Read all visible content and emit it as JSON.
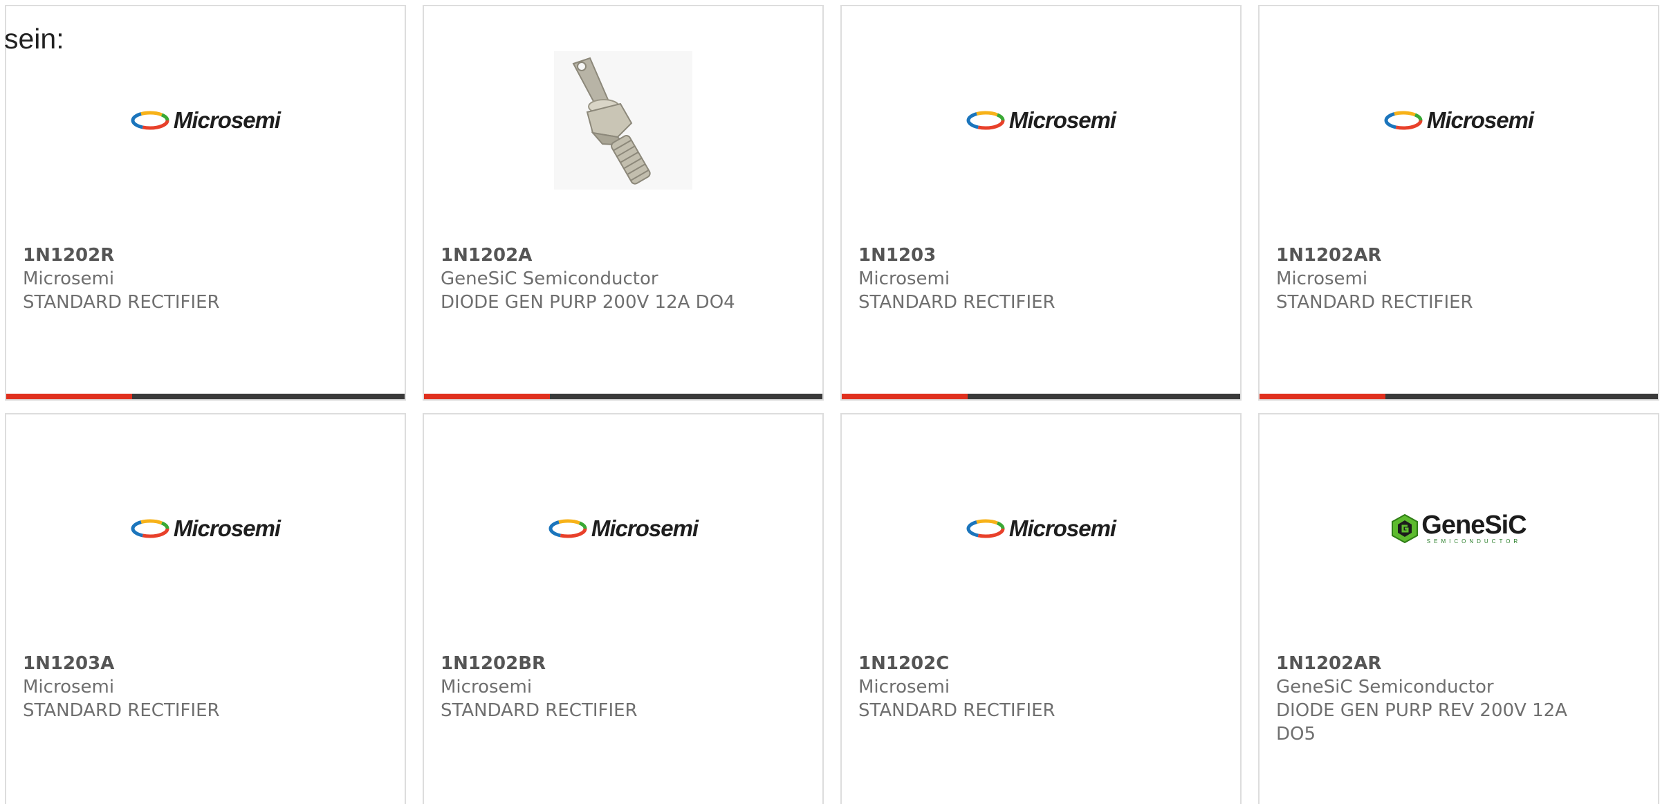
{
  "intro_text": "sein:",
  "logo_text": {
    "microsemi": "Microsemi",
    "genesic": "GeneSiC",
    "genesic_sub": "SEMICONDUCTOR"
  },
  "colors": {
    "accent": "#e0301e",
    "bar": "#3a3a3a",
    "text": "#6f6f6f",
    "border": "#dddddd"
  },
  "products": [
    {
      "part": "1N1202R",
      "manufacturer": "Microsemi",
      "description": "STANDARD RECTIFIER",
      "image": "microsemi-logo"
    },
    {
      "part": "1N1202A",
      "manufacturer": "GeneSiC Semiconductor",
      "description": "DIODE GEN PURP 200V 12A DO4",
      "image": "stud-diode-photo"
    },
    {
      "part": "1N1203",
      "manufacturer": "Microsemi",
      "description": "STANDARD RECTIFIER",
      "image": "microsemi-logo"
    },
    {
      "part": "1N1202AR",
      "manufacturer": "Microsemi",
      "description": "STANDARD RECTIFIER",
      "image": "microsemi-logo"
    },
    {
      "part": "1N1203A",
      "manufacturer": "Microsemi",
      "description": "STANDARD RECTIFIER",
      "image": "microsemi-logo"
    },
    {
      "part": "1N1202BR",
      "manufacturer": "Microsemi",
      "description": "STANDARD RECTIFIER",
      "image": "microsemi-logo"
    },
    {
      "part": "1N1202C",
      "manufacturer": "Microsemi",
      "description": "STANDARD RECTIFIER",
      "image": "microsemi-logo"
    },
    {
      "part": "1N1202AR",
      "manufacturer": "GeneSiC Semiconductor",
      "description": "DIODE GEN PURP REV 200V 12A DO5",
      "image": "genesic-logo"
    }
  ]
}
